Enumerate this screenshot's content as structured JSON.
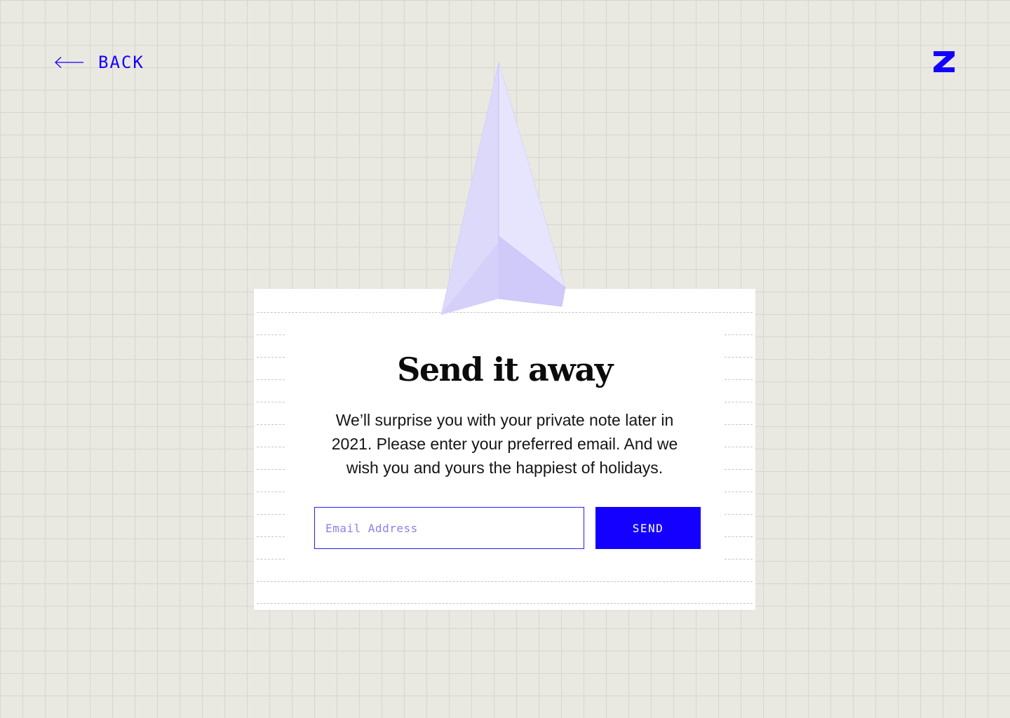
{
  "header": {
    "back_label": "BACK",
    "back_icon": "arrow-left-icon",
    "logo_icon": "z-logo-icon"
  },
  "card": {
    "title": "Send it away",
    "message": "We’ll surprise you with your private note later in 2021. Please enter your preferred email. And we wish you and yours the happiest of holidays.",
    "email_placeholder": "Email Address",
    "email_value": "",
    "send_label": "SEND",
    "illustration_icon": "paper-plane-icon"
  },
  "colors": {
    "accent": "#1400ff",
    "background": "#e9e9e2",
    "grid": "#d6d6cf",
    "card": "#ffffff",
    "plane": "#d9d6fb"
  }
}
